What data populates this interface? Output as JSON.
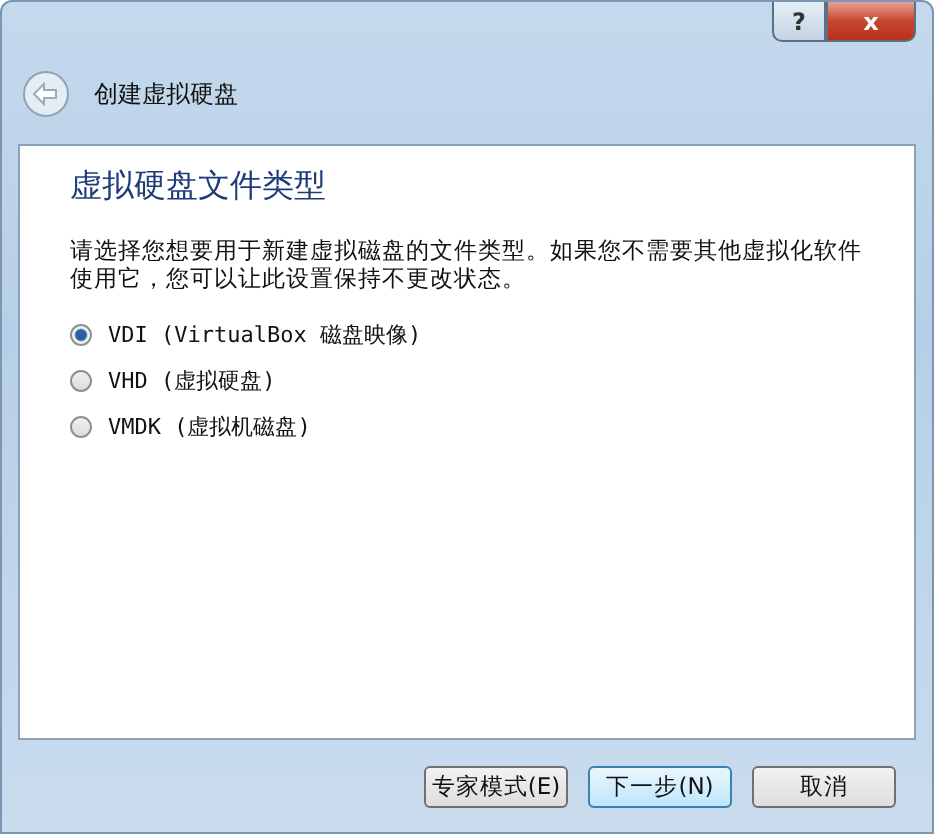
{
  "window": {
    "title": "创建虚拟硬盘",
    "help": "?",
    "close": "x"
  },
  "heading": "虚拟硬盘文件类型",
  "description": "请选择您想要用于新建虚拟磁盘的文件类型。如果您不需要其他虚拟化软件使用它，您可以让此设置保持不更改状态。",
  "options": [
    {
      "label": "VDI (VirtualBox 磁盘映像)",
      "selected": true
    },
    {
      "label": "VHD (虚拟硬盘)",
      "selected": false
    },
    {
      "label": "VMDK (虚拟机磁盘)",
      "selected": false
    }
  ],
  "buttons": [
    {
      "label": "专家模式(E)",
      "default": false
    },
    {
      "label": "下一步(N)",
      "default": true
    },
    {
      "label": "取消",
      "default": false
    }
  ]
}
